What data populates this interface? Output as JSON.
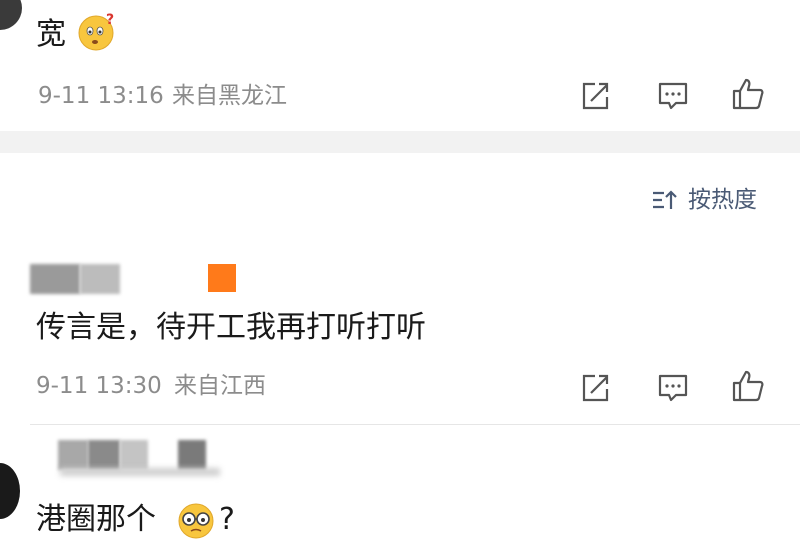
{
  "comments": [
    {
      "text": "宽",
      "emoji": "confused-face-emoji",
      "time": "9-11 13:16",
      "location": "来自黑龙江"
    },
    {
      "text": "传言是，待开工我再打听打听",
      "time": "9-11 13:30",
      "location": "来自江西"
    },
    {
      "text": "港圈那个",
      "emoji": "glasses-face-emoji",
      "suffix": "?"
    }
  ],
  "sort": {
    "label": "按热度",
    "icon": "sort-icon"
  },
  "actions": [
    "share-icon",
    "comment-icon",
    "like-icon"
  ],
  "colors": {
    "meta_text": "#8c8c8c",
    "sort_text": "#4a5a75",
    "badge": "#ff7a1a",
    "separator": "#f2f2f2"
  }
}
